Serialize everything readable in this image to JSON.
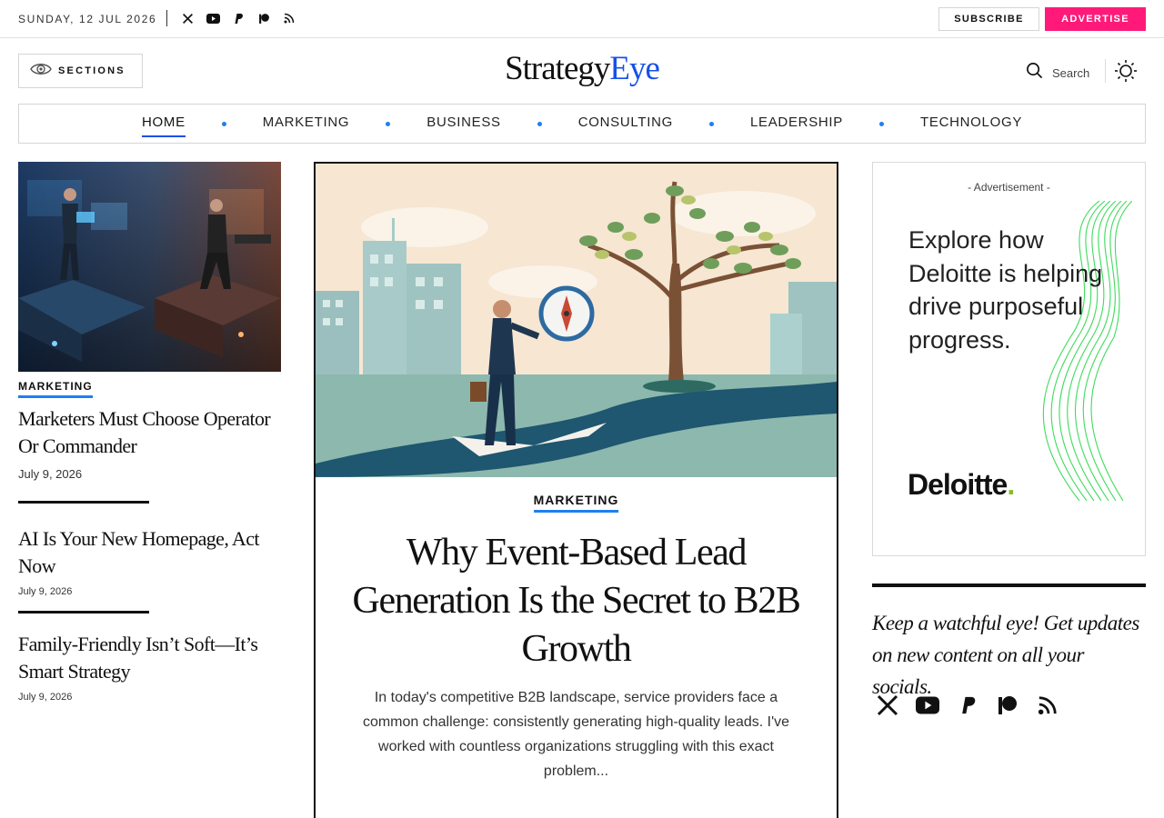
{
  "topbar": {
    "date": "SUNDAY, 12 JUL 2026",
    "socials": [
      "x-icon",
      "youtube-icon",
      "paypal-icon",
      "patreon-icon",
      "rss-icon"
    ],
    "subscribe_label": "SUBSCRIBE",
    "advertise_label": "ADVERTISE"
  },
  "header": {
    "sections_label": "SECTIONS",
    "logo_part1": "Strategy",
    "logo_part2": "Eye",
    "search_label": "Search"
  },
  "nav": {
    "items": [
      "HOME",
      "MARKETING",
      "BUSINESS",
      "CONSULTING",
      "LEADERSHIP",
      "TECHNOLOGY"
    ],
    "active": "HOME"
  },
  "left": {
    "articles": [
      {
        "category": "MARKETING",
        "title": "Marketers Must Choose Operator Or Commander",
        "date": "July 9, 2026"
      },
      {
        "title": "AI Is Your New Homepage, Act Now",
        "date": "July 9, 2026"
      },
      {
        "title": "Family-Friendly Isn’t Soft—It’s Smart Strategy",
        "date": "July 9, 2026"
      }
    ]
  },
  "featured": {
    "category": "MARKETING",
    "title": "Why Event-Based Lead Generation Is the Secret to B2B Growth",
    "excerpt": "In today's competitive B2B landscape, service providers face a common challenge: consistently generating high-quality leads. I've worked with countless organizations struggling with this exact problem..."
  },
  "sidebar": {
    "ad_label": "- Advertisement -",
    "ad_text": "Explore how Deloitte is helping drive purposeful progress.",
    "ad_logo": "Deloitte",
    "ad_logo_dot": ".",
    "follow_text": "Keep a watchful eye! Get updates on new content on all your socials.",
    "socials": [
      "x-icon",
      "youtube-icon",
      "paypal-icon",
      "patreon-icon",
      "rss-icon"
    ]
  },
  "colors": {
    "accent_blue": "#1650e8",
    "category_underline": "#1f7ff0",
    "advertise_pink": "#ff1a7a",
    "deloitte_green": "#86bc25"
  }
}
